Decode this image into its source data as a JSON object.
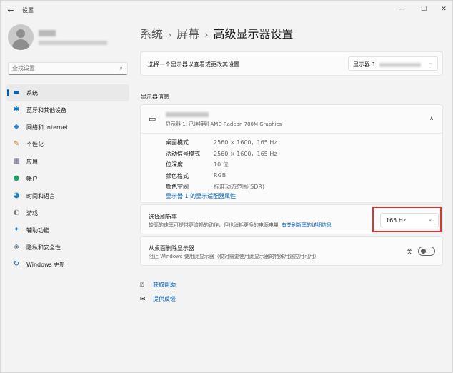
{
  "window": {
    "back_glyph": "←",
    "title": "设置",
    "controls": {
      "minimize": "—",
      "maximize": "☐",
      "close": "✕"
    }
  },
  "search": {
    "placeholder": "查找设置",
    "icon": "search-icon",
    "glyph": "⌕"
  },
  "sidebar": {
    "items": [
      {
        "label": "系统",
        "icon": "system-icon",
        "glyph": "▬",
        "color": "#0067c0",
        "active": true
      },
      {
        "label": "蓝牙和其他设备",
        "icon": "bluetooth-icon",
        "glyph": "✱",
        "color": "#0078d4"
      },
      {
        "label": "网络和 Internet",
        "icon": "network-icon",
        "glyph": "◆",
        "color": "#2b88d8"
      },
      {
        "label": "个性化",
        "icon": "personalization-icon",
        "glyph": "✎",
        "color": "#c07a2c"
      },
      {
        "label": "应用",
        "icon": "apps-icon",
        "glyph": "▦",
        "color": "#6a6a8a"
      },
      {
        "label": "帐户",
        "icon": "accounts-icon",
        "glyph": "●",
        "color": "#1f9e6a"
      },
      {
        "label": "时间和语言",
        "icon": "time-language-icon",
        "glyph": "◕",
        "color": "#1a7fc9"
      },
      {
        "label": "游戏",
        "icon": "gaming-icon",
        "glyph": "◐",
        "color": "#7a7a7a"
      },
      {
        "label": "辅助功能",
        "icon": "accessibility-icon",
        "glyph": "✦",
        "color": "#1a6fc0"
      },
      {
        "label": "隐私和安全性",
        "icon": "privacy-shield-icon",
        "glyph": "◈",
        "color": "#5a6a7a"
      },
      {
        "label": "Windows 更新",
        "icon": "windows-update-icon",
        "glyph": "↻",
        "color": "#0f6fc6"
      }
    ]
  },
  "breadcrumb": {
    "items": [
      "系统",
      "屏幕"
    ],
    "separator": "›",
    "current": "高级显示器设置"
  },
  "select_display": {
    "label": "选择一个显示器以查看或更改其设置",
    "dropdown_value": "显示器 1:",
    "chevron": "⌄"
  },
  "display_info": {
    "heading": "显示器信息",
    "monitor_icon": "monitor-icon",
    "monitor_glyph": "▭",
    "subtitle": "显示器 1: 已连接到 AMD Radeon 780M Graphics",
    "collapse_glyph": "∧",
    "rows": [
      {
        "key": "桌面模式",
        "value": "2560 × 1600，165 Hz"
      },
      {
        "key": "活动信号模式",
        "value": "2560 × 1600，165 Hz"
      },
      {
        "key": "位深度",
        "value": "10 位"
      },
      {
        "key": "颜色格式",
        "value": "RGB"
      },
      {
        "key": "颜色空间",
        "value": "标准动态范围(SDR)"
      }
    ],
    "adapter_link": "显示器 1 的显示适配器属性"
  },
  "refresh_rate": {
    "title": "选择刷新率",
    "description": "较高的速率可提供更流畅的动作，但也消耗更多的电源电量",
    "link": "有关刷新率的详细信息",
    "value": "165 Hz",
    "chevron": "⌄",
    "highlight_color": "#e3312d"
  },
  "remove_display": {
    "title": "从桌面删除显示器",
    "description": "阻止 Windows 使用此显示器（仅对需要使用此显示器的特殊用途应用可用）",
    "toggle_label": "关",
    "toggle_on": false
  },
  "help": {
    "get_help": "获取帮助",
    "get_help_glyph": "⍰",
    "feedback": "提供反馈",
    "feedback_glyph": "✉"
  },
  "colors": {
    "accent": "#005fb8",
    "background": "#f3f3f3",
    "card": "#fbfbfb"
  }
}
